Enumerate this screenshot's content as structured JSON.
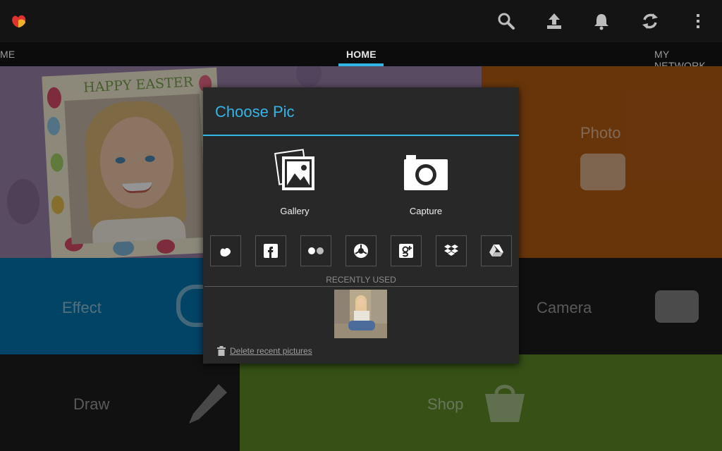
{
  "actionbar": {
    "icons": [
      "search-icon",
      "upload-icon",
      "notifications-icon",
      "sync-icon",
      "overflow-menu-icon"
    ]
  },
  "tabs": [
    {
      "label": "ME"
    },
    {
      "label": "HOME",
      "active": true
    },
    {
      "label": "MY NETWORK"
    }
  ],
  "home": {
    "easter_card_text": "HAPPY EASTER",
    "photo_label": "Photo",
    "effect_label": "Effect",
    "camera_label": "Camera",
    "draw_label": "Draw",
    "shop_label": "Shop"
  },
  "dialog": {
    "title": "Choose Pic",
    "gallery_label": "Gallery",
    "capture_label": "Capture",
    "sources": [
      "picsart-icon",
      "facebook-icon",
      "flickr-icon",
      "picasa-icon",
      "google-plus-icon",
      "dropbox-icon",
      "google-drive-icon"
    ],
    "recent_label": "RECENTLY USED",
    "delete_label": "Delete recent pictures"
  },
  "colors": {
    "accent": "#33b5e5",
    "photo_tile": "#b35c14",
    "effect_tile": "#0576ae",
    "shop_tile": "#5e8a26",
    "drawing_tile": "#9a82a7"
  }
}
